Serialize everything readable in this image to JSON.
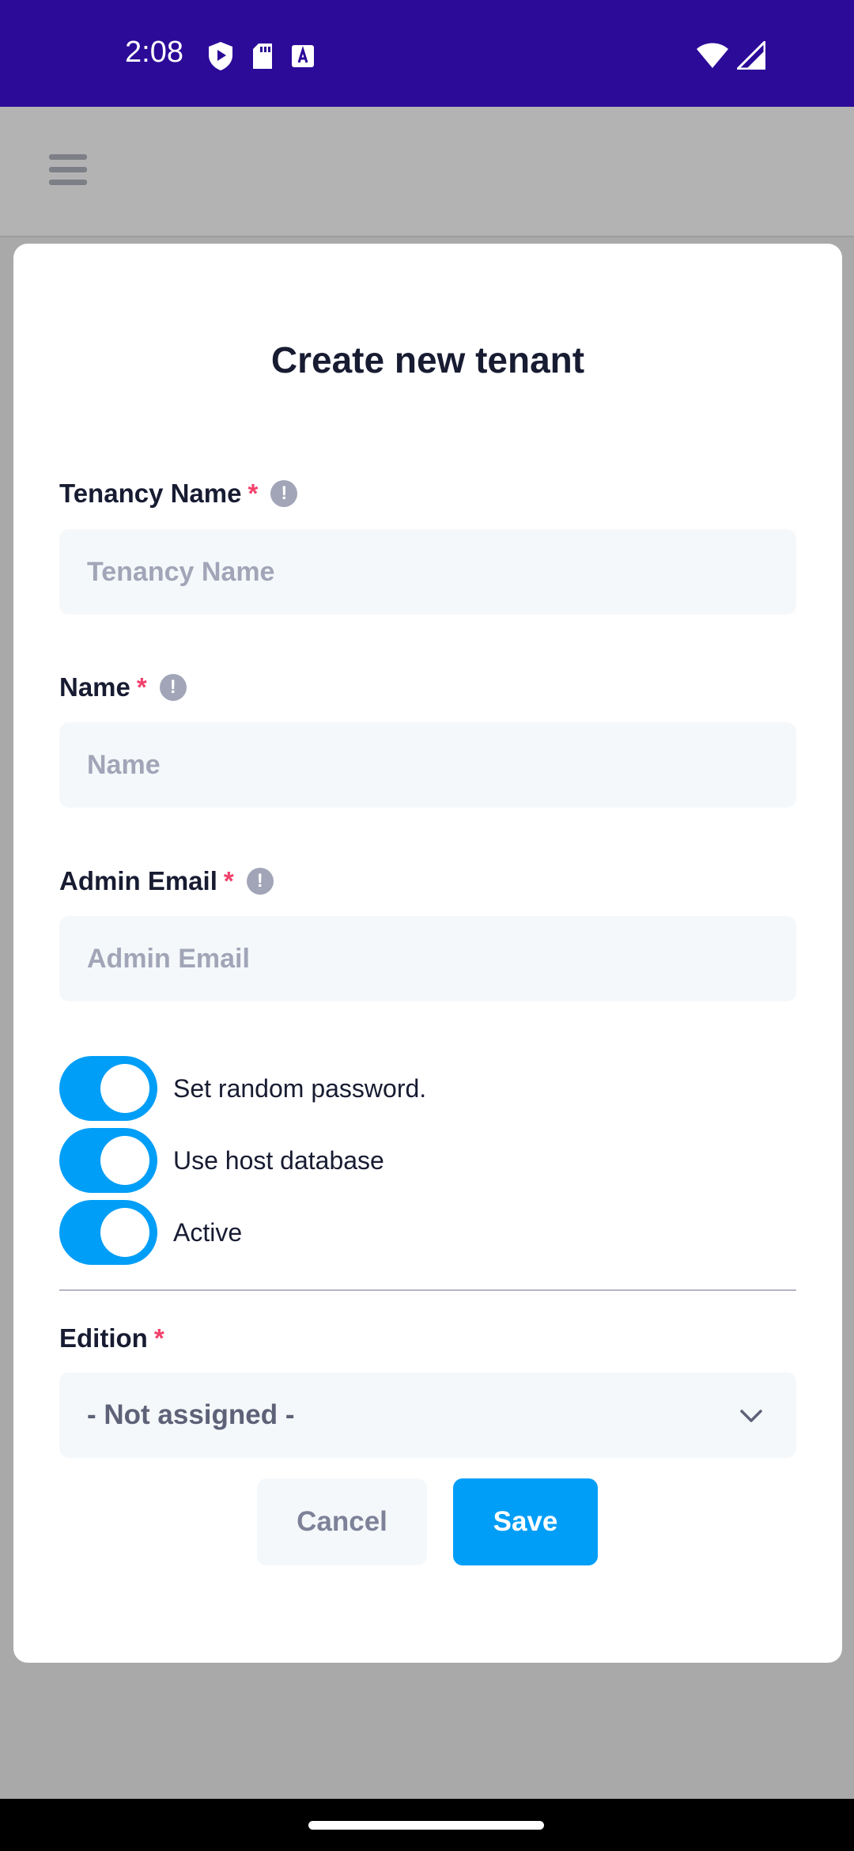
{
  "status_bar": {
    "time": "2:08",
    "left_icons": [
      "shield-play-icon",
      "sd-card-icon",
      "text-a-icon"
    ],
    "right_icons": [
      "wifi-icon",
      "cell-signal-icon"
    ],
    "background": "#2c0b98"
  },
  "app_bar": {
    "menu_icon": "hamburger-menu-icon"
  },
  "modal": {
    "title": "Create new tenant",
    "fields": {
      "tenancy_name": {
        "label": "Tenancy Name",
        "required_mark": "*",
        "placeholder": "Tenancy Name",
        "value": ""
      },
      "name": {
        "label": "Name",
        "required_mark": "*",
        "placeholder": "Name",
        "value": ""
      },
      "admin_email": {
        "label": "Admin Email",
        "required_mark": "*",
        "placeholder": "Admin Email",
        "value": ""
      }
    },
    "toggles": [
      {
        "label": "Set random password.",
        "on": true
      },
      {
        "label": "Use host database",
        "on": true
      },
      {
        "label": "Active",
        "on": true
      }
    ],
    "edition": {
      "label": "Edition",
      "required_mark": "*",
      "selected": "- Not assigned -"
    },
    "buttons": {
      "cancel": "Cancel",
      "save": "Save"
    }
  },
  "colors": {
    "accent": "#009ef7",
    "required": "#f1416c",
    "input_bg": "#f5f8fa",
    "overlay": "#a9a9aa"
  }
}
